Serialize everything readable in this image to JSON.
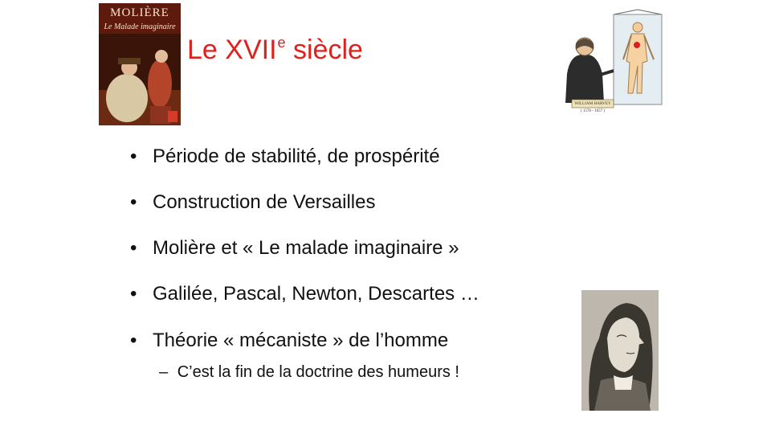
{
  "slide": {
    "title_main": "Le XVII",
    "title_sup": "e",
    "title_rest": " siècle",
    "title_color": "#e0201c",
    "bullet_glyph": "•",
    "sub_glyph": "–",
    "bullets": [
      "Période de stabilité, de prospérité",
      "Construction de Versailles",
      "Molière et « Le malade imaginaire »",
      "Galilée, Pascal, Newton, Descartes …",
      "Théorie « mécaniste » de l’homme"
    ],
    "sub_bullet": "C’est la fin de la doctrine des humeurs !"
  },
  "book_cover": {
    "author": "MOLIÈRE",
    "title": "Le Malade imaginaire"
  },
  "harvey_figure": {
    "caption_line1": "WILLIAM HARVEY",
    "caption_line2": "( 1578 - 1657 )"
  }
}
